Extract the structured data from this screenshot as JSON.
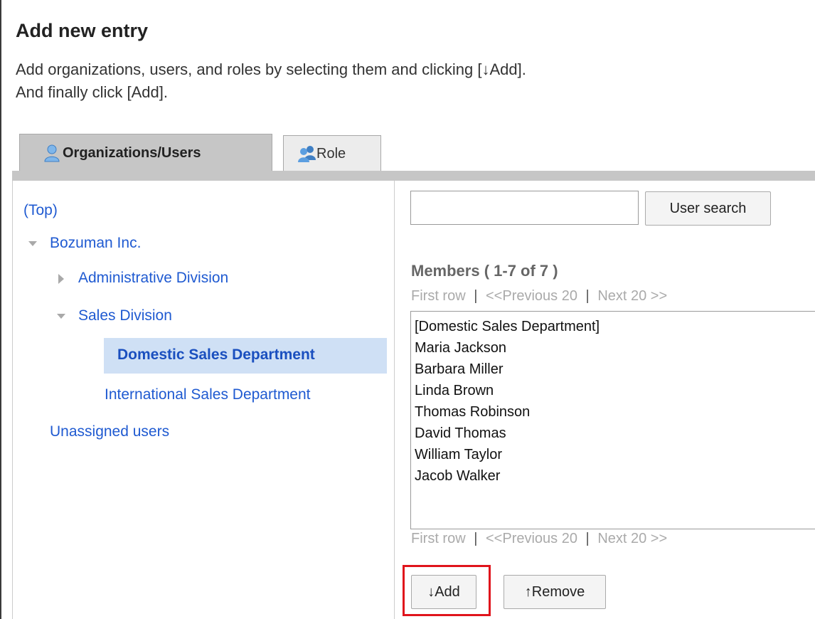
{
  "page": {
    "title": "Add new entry",
    "description_line1": "Add organizations, users, and roles by selecting them and clicking [↓Add].",
    "description_line2": "And finally click [Add]."
  },
  "tabs": [
    {
      "label": "Organizations/Users",
      "icon": "user-icon",
      "active": true
    },
    {
      "label": "Role",
      "icon": "role-icon",
      "active": false
    }
  ],
  "tree": {
    "top_link": "(Top)",
    "root": "Bozuman Inc.",
    "admin_division": "Administrative Division",
    "sales_division": "Sales Division",
    "domestic_sales": "Domestic Sales Department",
    "international_sales": "International Sales Department",
    "unassigned": "Unassigned users"
  },
  "search": {
    "value": "",
    "button_label": "User search"
  },
  "members": {
    "title": "Members ( 1-7 of 7 )",
    "pager": {
      "first": "First row",
      "sep": "|",
      "previous": "<<Previous 20",
      "next": "Next 20 >>"
    },
    "items": [
      "[Domestic Sales Department]",
      "Maria Jackson",
      "Barbara Miller",
      "Linda Brown",
      "Thomas Robinson",
      "David Thomas",
      "William Taylor",
      "Jacob Walker"
    ]
  },
  "actions": {
    "add_label": "↓Add",
    "remove_label": "↑Remove"
  },
  "colors": {
    "link": "#1f5ad1",
    "highlight": "#e0141c",
    "selected_bg": "#cfe0f5"
  }
}
